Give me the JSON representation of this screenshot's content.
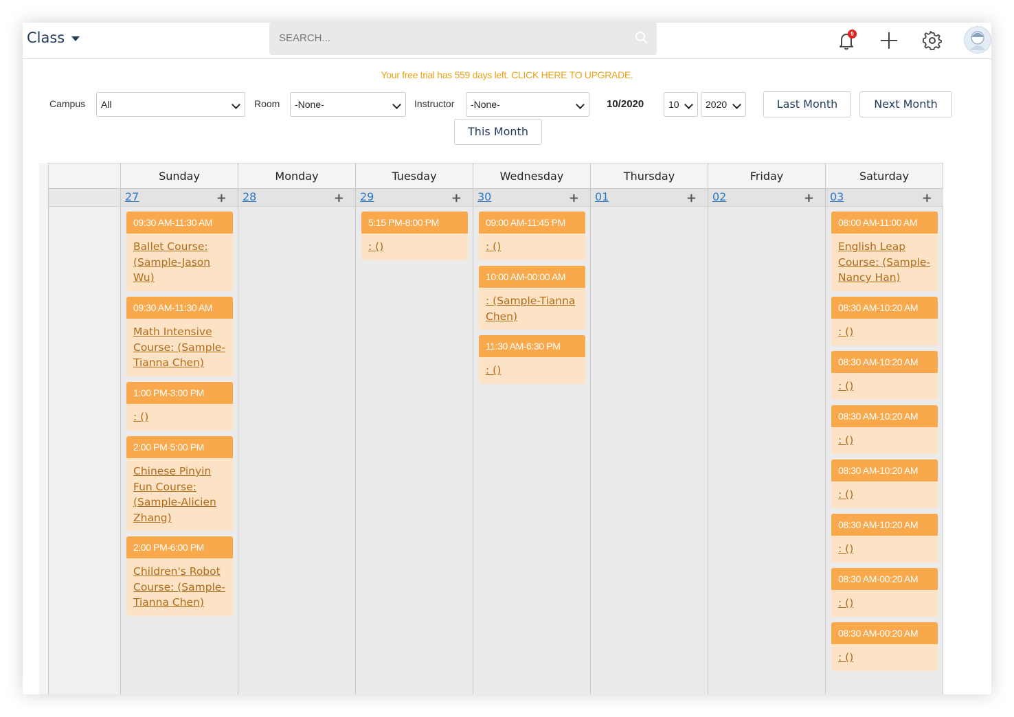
{
  "header": {
    "title": "Class",
    "search_placeholder": "SEARCH...",
    "notification_count": "9"
  },
  "trial": {
    "message": "Your free trial has 559 days left.",
    "upgrade_link": "CLICK HERE TO UPGRADE."
  },
  "filters": {
    "campus_label": "Campus",
    "campus_value": "All",
    "room_label": "Room",
    "room_value": "-None-",
    "instructor_label": "Instructor",
    "instructor_value": "-None-",
    "current_month": "10/2020",
    "month_value": "10",
    "year_value": "2020",
    "last_month_label": "Last Month",
    "next_month_label": "Next Month",
    "this_month_label": "This Month"
  },
  "calendar": {
    "days": [
      {
        "name": "Sunday",
        "date": "27",
        "events": [
          {
            "time": "09:30 AM-11:30 AM",
            "title": "Ballet Course:  (Sample-Jason Wu)"
          },
          {
            "time": "09:30 AM-11:30 AM",
            "title": "Math Intensive Course:  (Sample-Tianna Chen)"
          },
          {
            "time": "1:00 PM-3:00 PM",
            "title": ": ()"
          },
          {
            "time": "2:00 PM-5:00 PM",
            "title": "Chinese Pinyin Fun Course:  (Sample-Alicien Zhang)"
          },
          {
            "time": "2:00 PM-6:00 PM",
            "title": "Children's Robot Course:  (Sample-Tianna Chen)"
          }
        ]
      },
      {
        "name": "Monday",
        "date": "28",
        "events": []
      },
      {
        "name": "Tuesday",
        "date": "29",
        "events": [
          {
            "time": "5:15 PM-8:00 PM",
            "title": ": ()"
          }
        ]
      },
      {
        "name": "Wednesday",
        "date": "30",
        "events": [
          {
            "time": "09:00 AM-11:45 PM",
            "title": ": ()"
          },
          {
            "time": "10:00 AM-00:00 AM",
            "title": ": (Sample-Tianna Chen)"
          },
          {
            "time": "11:30 AM-6:30 PM",
            "title": ": ()"
          }
        ]
      },
      {
        "name": "Thursday",
        "date": "01",
        "events": []
      },
      {
        "name": "Friday",
        "date": "02",
        "events": []
      },
      {
        "name": "Saturday",
        "date": "03",
        "events": [
          {
            "time": "08:00 AM-11:00 AM",
            "title": "English Leap Course:  (Sample-Nancy Han)"
          },
          {
            "time": "08:30 AM-10:20 AM",
            "title": ": ()"
          },
          {
            "time": "08:30 AM-10:20 AM",
            "title": ": ()"
          },
          {
            "time": "08:30 AM-10:20 AM",
            "title": ": ()"
          },
          {
            "time": "08:30 AM-10:20 AM",
            "title": ": ()"
          },
          {
            "time": "08:30 AM-10:20 AM",
            "title": ": ()"
          },
          {
            "time": "08:30 AM-00:20 AM",
            "title": ": ()"
          },
          {
            "time": "08:30 AM-00:20 AM",
            "title": ": ()"
          }
        ]
      }
    ]
  },
  "colors": {
    "event_header": "#f9a94c",
    "event_body": "#fde3c6",
    "event_link": "#b06a16",
    "date_link": "#2a78c9",
    "trial_text": "#e8a317",
    "title_text": "#1f3b5a"
  },
  "icons": [
    "chevron-down-icon",
    "search-icon",
    "bell-icon",
    "plus-icon",
    "gear-icon",
    "avatar"
  ]
}
